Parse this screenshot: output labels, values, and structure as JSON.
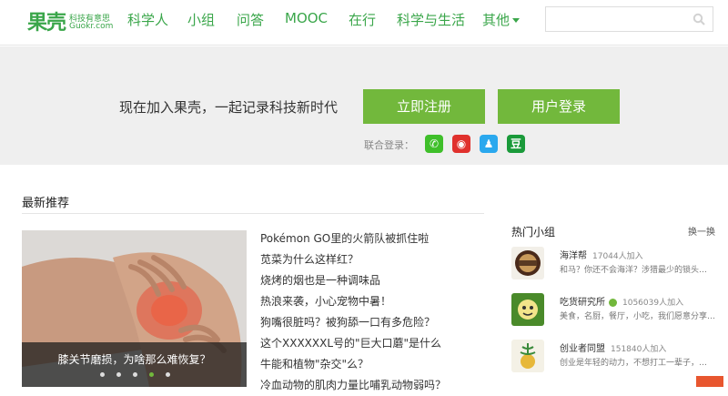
{
  "logo": {
    "cn": "果壳",
    "tagline": "科技有意思",
    "en": "Guokr.com"
  },
  "nav": [
    {
      "label": "科学人"
    },
    {
      "label": "小组"
    },
    {
      "label": "问答"
    },
    {
      "label": "MOOC"
    },
    {
      "label": "在行"
    },
    {
      "label": "科学与生活"
    },
    {
      "label": "其他"
    }
  ],
  "search": {
    "placeholder": ""
  },
  "banner": {
    "text": "现在加入果壳，一起记录科技新时代",
    "register_label": "立即注册",
    "login_label": "用户登录",
    "joint_login_label": "联合登录：",
    "sns": {
      "wechat": "✆",
      "weibo": "◉",
      "qq": "♟",
      "douban": "豆"
    }
  },
  "latest": {
    "title": "最新推荐",
    "slide_caption": "膝关节磨损，为啥那么难恢复？",
    "slide_count": 5,
    "active_slide": 4,
    "items": [
      "Pokémon GO里的火箭队被抓住啦",
      "苋菜为什么这样红？",
      "烧烤的烟也是一种调味品",
      "热浪来袭，小心宠物中暑！",
      "狗嘴很脏吗？被狗舔一口有多危险？",
      "这个XXXXXXL号的\"巨大口蘑\"是什么",
      "牛能和植物\"杂交\"么？",
      "冷血动物的肌肉力量比哺乳动物弱吗？"
    ]
  },
  "hot_groups": {
    "title": "热门小组",
    "swap_label": "换一换",
    "groups": [
      {
        "name": "海洋帮",
        "count": "17044人加入",
        "desc": "和马？你还不会海洋？涉猎最少的锁头…"
      },
      {
        "name": "吃货研究所",
        "count": "1056039人加入",
        "desc": "美食，名厨，餐厅，小吃，我们愿意分享…"
      },
      {
        "name": "创业者同盟",
        "count": "151840人加入",
        "desc": "创业是年轻的动力，不想打工一辈子，…"
      }
    ]
  },
  "colors": {
    "brand_green": "#3aa64a",
    "button_green": "#72b83c"
  }
}
